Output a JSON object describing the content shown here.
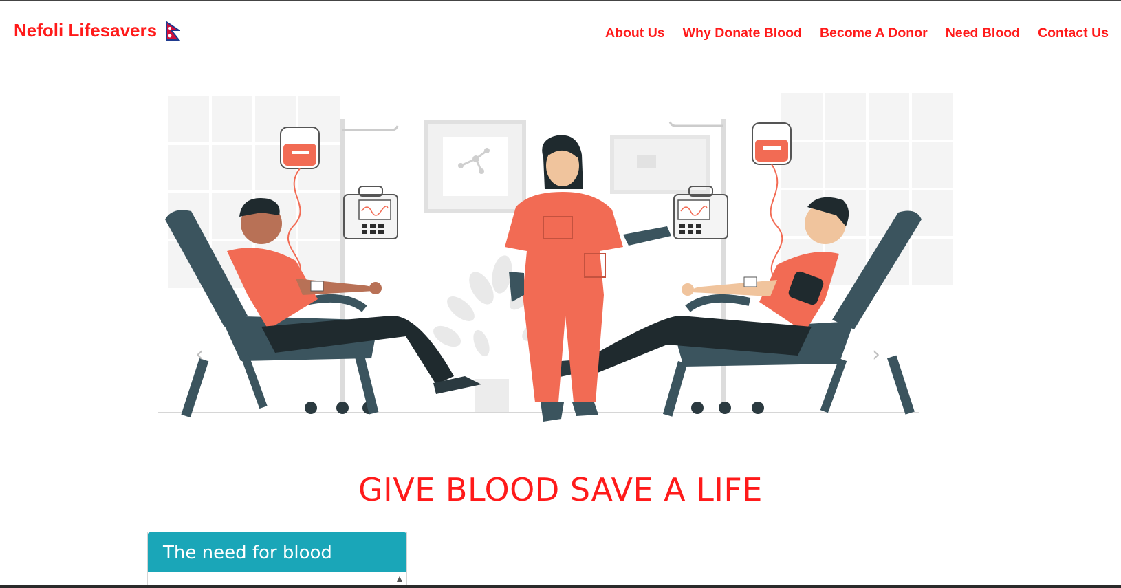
{
  "brand": {
    "name": "Nefoli Lifesavers",
    "flag_icon": "nepal-flag-icon"
  },
  "nav": {
    "items": [
      {
        "label": "About Us"
      },
      {
        "label": "Why Donate Blood"
      },
      {
        "label": "Become A Donor"
      },
      {
        "label": "Need Blood"
      },
      {
        "label": "Contact Us"
      }
    ]
  },
  "hero": {
    "prev_icon": "chevron-left-icon",
    "next_icon": "chevron-right-icon"
  },
  "tagline": "GIVE BLOOD SAVE A LIFE",
  "need_card": {
    "title": "The need for blood"
  },
  "colors": {
    "accent_red": "#ff1a1a",
    "card_header": "#1aa6b8",
    "scrub_orange": "#f26b54",
    "chair_slate": "#3b545e"
  }
}
